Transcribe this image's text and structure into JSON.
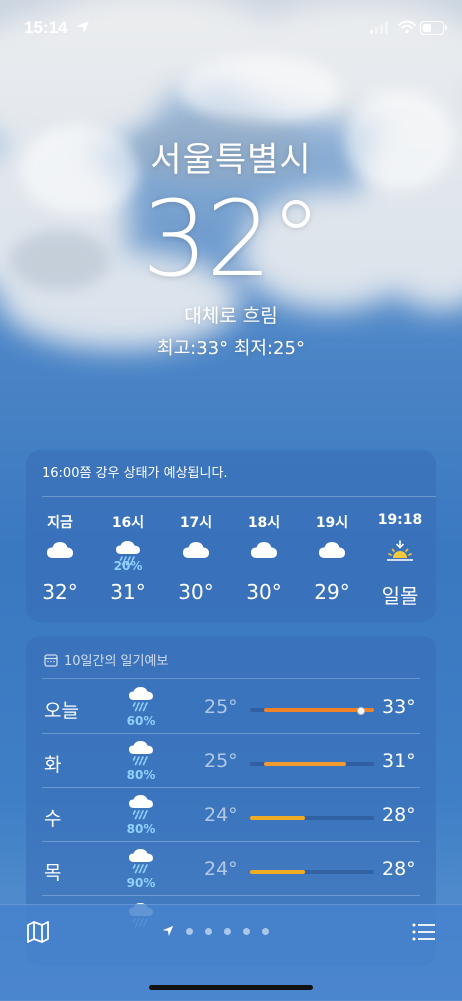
{
  "status": {
    "time": "15:14"
  },
  "current": {
    "city": "서울특별시",
    "temp": "32°",
    "condition": "대체로 흐림",
    "hilo": "최고:33°  최저:25°"
  },
  "hourly": {
    "summary": "16:00쯤 강우 상태가 예상됩니다.",
    "items": [
      {
        "label": "지금",
        "icon": "cloud-icon",
        "pct": "",
        "temp": "32°"
      },
      {
        "label": "16시",
        "icon": "cloud-rain-icon",
        "pct": "20%",
        "temp": "31°"
      },
      {
        "label": "17시",
        "icon": "cloud-icon",
        "pct": "",
        "temp": "30°"
      },
      {
        "label": "18시",
        "icon": "cloud-icon",
        "pct": "",
        "temp": "30°"
      },
      {
        "label": "19시",
        "icon": "cloud-icon",
        "pct": "",
        "temp": "29°"
      },
      {
        "label": "19:18",
        "icon": "sunset-icon",
        "pct": "",
        "temp": "일몰"
      }
    ]
  },
  "daily": {
    "header": "10일간의 일기예보",
    "range_min": 24,
    "range_max": 33,
    "items": [
      {
        "day": "오늘",
        "icon": "cloud-rain-icon",
        "pct": "60%",
        "low": "25°",
        "high": "33°",
        "low_val": 25,
        "high_val": 33,
        "current_val": 32,
        "color": "#f0832a"
      },
      {
        "day": "화",
        "icon": "cloud-rain-icon",
        "pct": "80%",
        "low": "25°",
        "high": "31°",
        "low_val": 25,
        "high_val": 31,
        "color": "#f19a2f"
      },
      {
        "day": "수",
        "icon": "cloud-rain-icon",
        "pct": "80%",
        "low": "24°",
        "high": "28°",
        "low_val": 24,
        "high_val": 28,
        "color": "#f0ac25"
      },
      {
        "day": "목",
        "icon": "cloud-rain-icon",
        "pct": "90%",
        "low": "24°",
        "high": "28°",
        "low_val": 24,
        "high_val": 28,
        "color": "#f0ac25"
      }
    ]
  },
  "bottom": {
    "pages": 6,
    "active_page": 0
  }
}
